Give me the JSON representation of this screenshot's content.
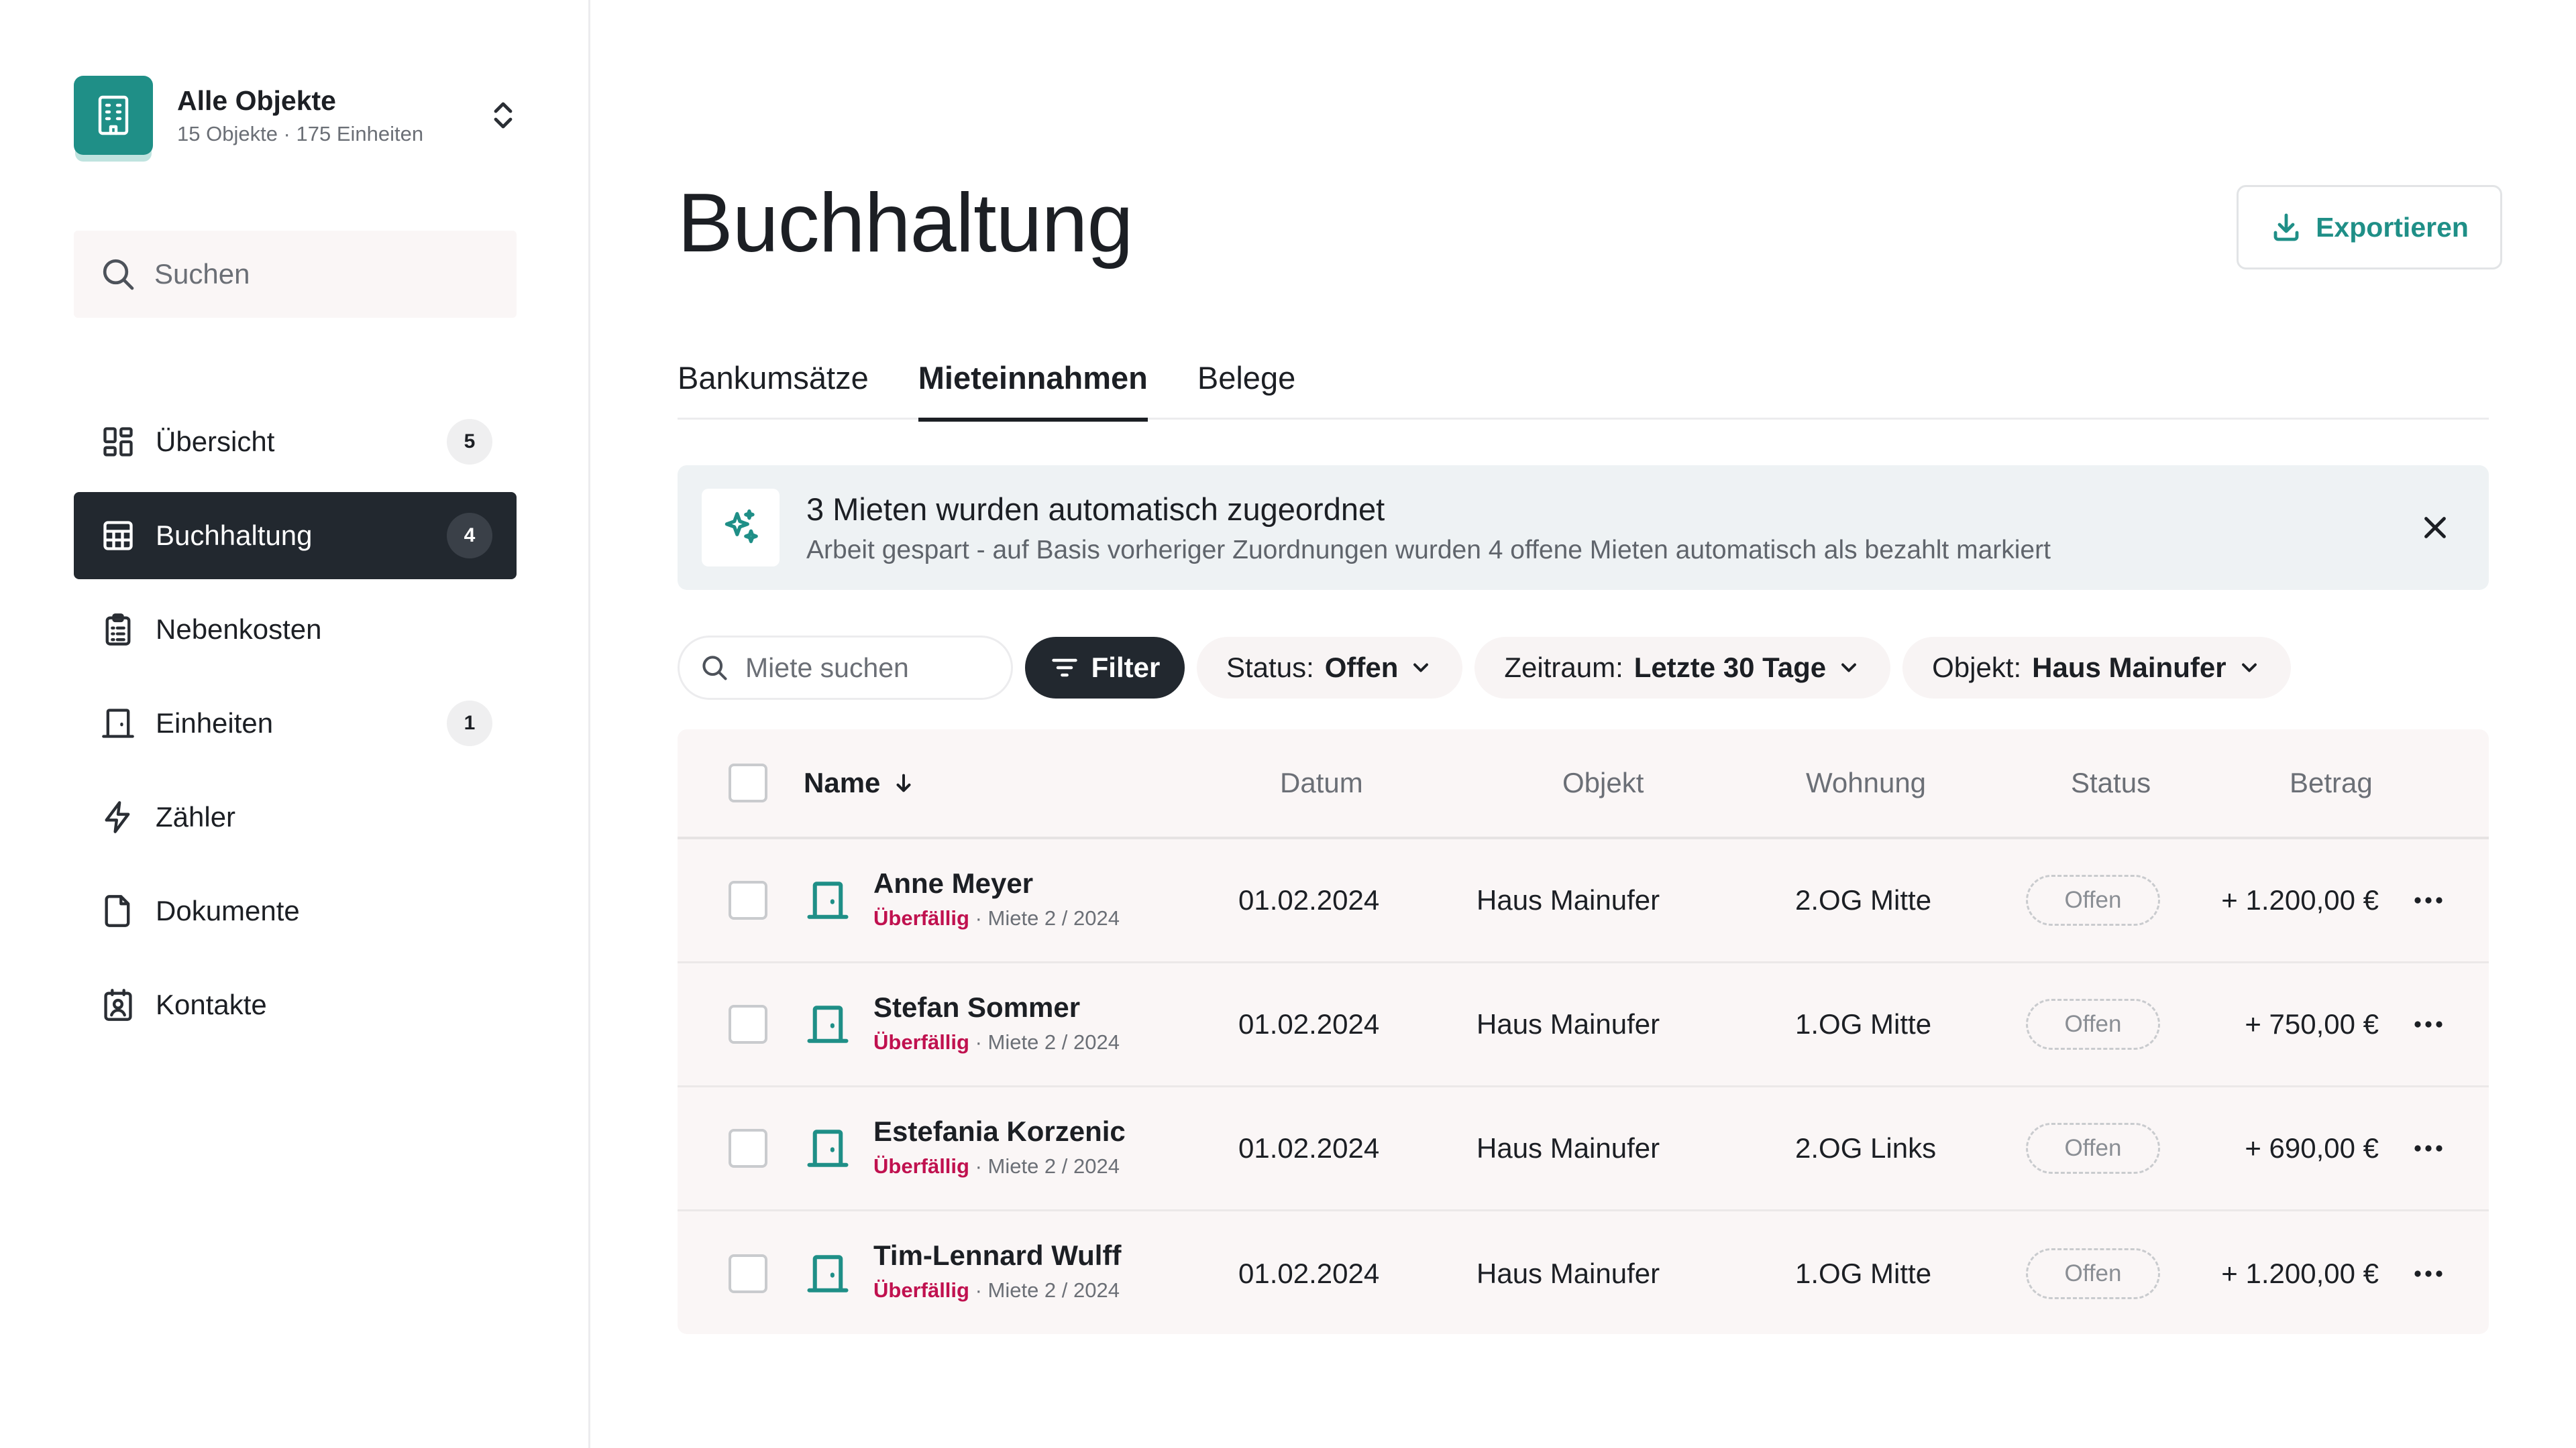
{
  "workspace": {
    "title": "Alle Objekte",
    "subtitle": "15 Objekte · 175 Einheiten",
    "logo_icon": "building-icon",
    "switch_icon": "chevron-up-down-icon"
  },
  "sidebar": {
    "search_placeholder": "Suchen",
    "items": [
      {
        "label": "Übersicht",
        "icon": "dashboard-icon",
        "count": "5",
        "active": false
      },
      {
        "label": "Buchhaltung",
        "icon": "table-icon",
        "count": "4",
        "active": true
      },
      {
        "label": "Nebenkosten",
        "icon": "clipboard-icon",
        "count": "",
        "active": false
      },
      {
        "label": "Einheiten",
        "icon": "door-icon",
        "count": "1",
        "active": false
      },
      {
        "label": "Zähler",
        "icon": "lightning-icon",
        "count": "",
        "active": false
      },
      {
        "label": "Dokumente",
        "icon": "document-icon",
        "count": "",
        "active": false
      },
      {
        "label": "Kontakte",
        "icon": "contact-icon",
        "count": "",
        "active": false
      }
    ]
  },
  "header": {
    "title": "Buchhaltung",
    "export_label": "Exportieren"
  },
  "tabs": [
    {
      "label": "Bankumsätze",
      "active": false
    },
    {
      "label": "Mieteinnahmen",
      "active": true
    },
    {
      "label": "Belege",
      "active": false
    }
  ],
  "banner": {
    "title": "3 Mieten wurden automatisch zugeordnet",
    "subtitle": "Arbeit gespart - auf Basis vorheriger Zuordnungen wurden 4 offene Mieten automatisch als bezahlt markiert"
  },
  "filters": {
    "search_placeholder": "Miete suchen",
    "filter_label": "Filter",
    "status_label": "Status:",
    "status_value": "Offen",
    "period_label": "Zeitraum:",
    "period_value": "Letzte 30 Tage",
    "object_label": "Objekt:",
    "object_value": "Haus Mainufer"
  },
  "table": {
    "columns": {
      "name": "Name",
      "date": "Datum",
      "object": "Objekt",
      "unit": "Wohnung",
      "status": "Status",
      "amount": "Betrag"
    },
    "rows": [
      {
        "name": "Anne Meyer",
        "state": "Überfällig",
        "meta": " · Miete 2 / 2024",
        "date": "01.02.2024",
        "object": "Haus Mainufer",
        "unit": "2.OG Mitte",
        "status": "Offen",
        "amount": "+ 1.200,00 €"
      },
      {
        "name": "Stefan Sommer",
        "state": "Überfällig",
        "meta": " · Miete 2 / 2024",
        "date": "01.02.2024",
        "object": "Haus Mainufer",
        "unit": "1.OG Mitte",
        "status": "Offen",
        "amount": "+ 750,00 €"
      },
      {
        "name": "Estefania Korzenic",
        "state": "Überfällig",
        "meta": " · Miete 2 / 2024",
        "date": "01.02.2024",
        "object": "Haus Mainufer",
        "unit": "2.OG Links",
        "status": "Offen",
        "amount": "+ 690,00 €"
      },
      {
        "name": "Tim-Lennard Wulff",
        "state": "Überfällig",
        "meta": " · Miete 2 / 2024",
        "date": "01.02.2024",
        "object": "Haus Mainufer",
        "unit": "1.OG Mitte",
        "status": "Offen",
        "amount": "+ 1.200,00 €"
      }
    ]
  },
  "colors": {
    "accent": "#1f8f87",
    "dark": "#22282f",
    "overdue": "#c0114f"
  }
}
